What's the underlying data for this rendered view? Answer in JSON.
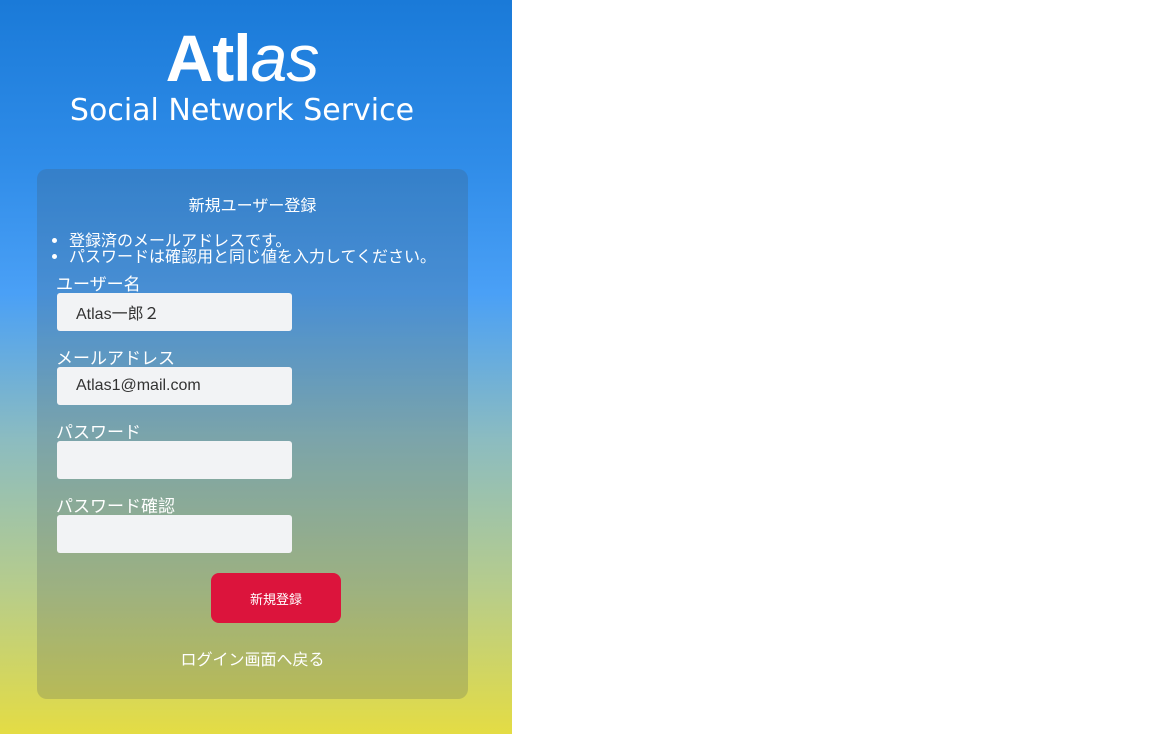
{
  "brand": {
    "logo_strong": "Atl",
    "logo_soft": "as",
    "tagline": "Social Network Service"
  },
  "form": {
    "title": "新規ユーザー登録",
    "errors": [
      "登録済のメールアドレスです。",
      "パスワードは確認用と同じ値を入力してください。"
    ],
    "fields": [
      {
        "label": "ユーザー名",
        "value": "Atlas一郎２"
      },
      {
        "label": "メールアドレス",
        "value": "Atlas1@mail.com"
      },
      {
        "label": "パスワード",
        "value": ""
      },
      {
        "label": "パスワード確認",
        "value": ""
      }
    ],
    "submit_label": "新規登録",
    "back_link": "ログイン画面へ戻る"
  },
  "colors": {
    "gradient_top": "#1a7ad8",
    "gradient_bottom": "#e4dc44",
    "button": "#dc143c",
    "input_bg": "#f2f3f5"
  }
}
